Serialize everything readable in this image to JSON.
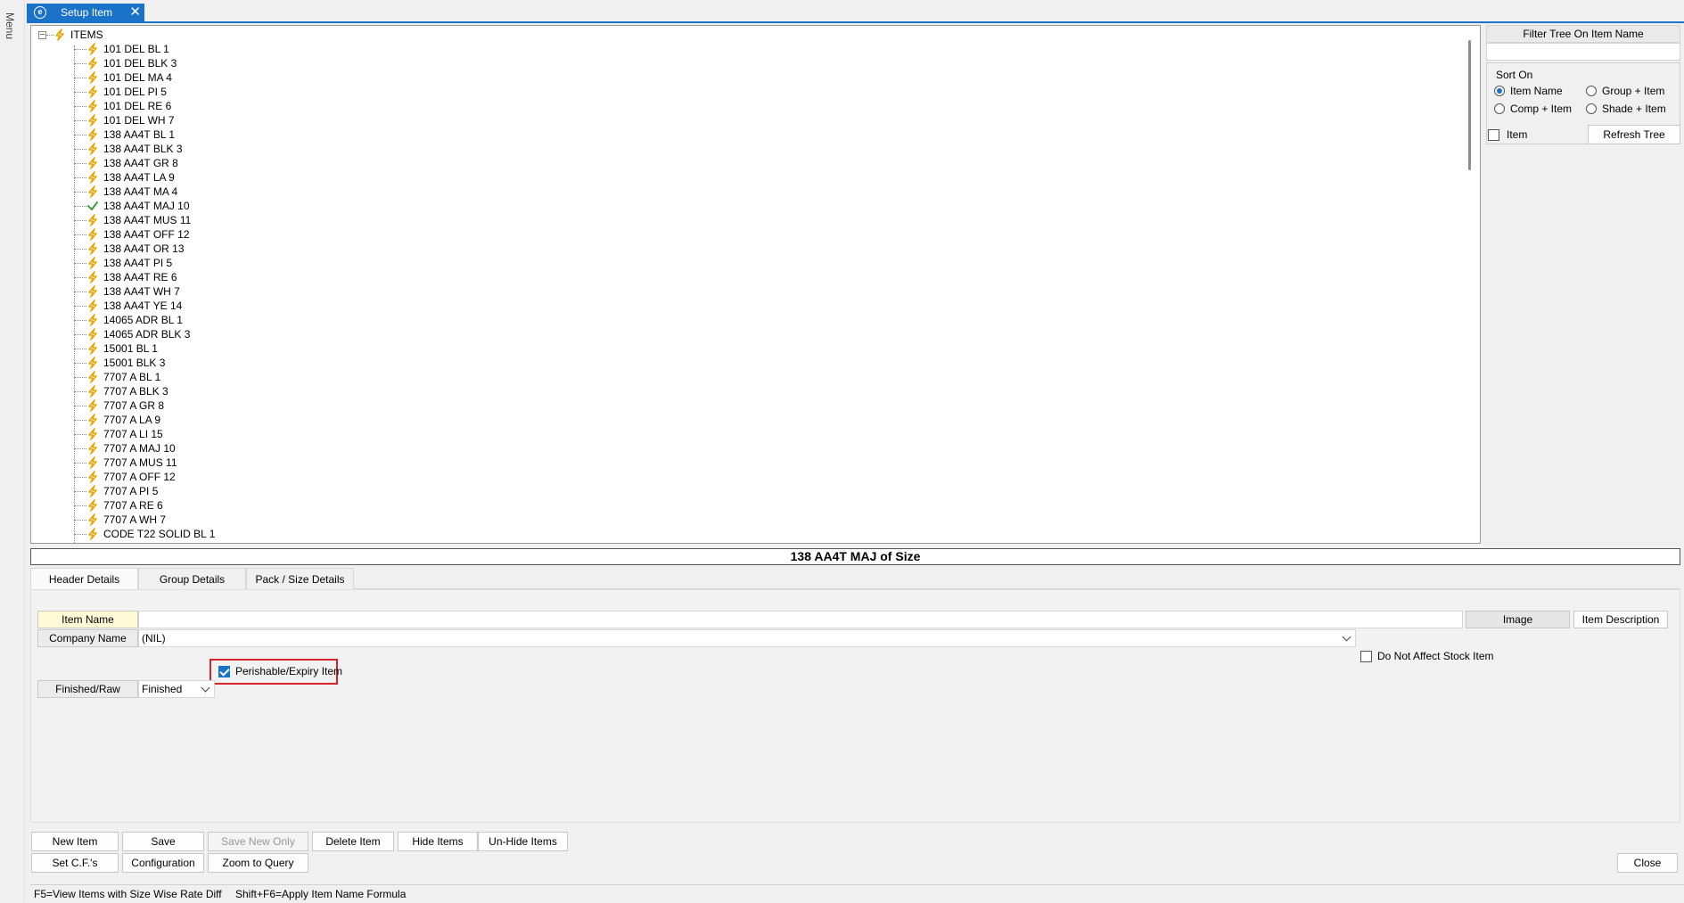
{
  "menu_label": "Menu",
  "window_tab": {
    "title": "Setup Item",
    "close": "✕"
  },
  "tree": {
    "root": "ITEMS",
    "items": [
      {
        "label": "101 DEL BL 1",
        "icon": "bolt"
      },
      {
        "label": "101 DEL BLK 3",
        "icon": "bolt"
      },
      {
        "label": "101 DEL MA 4",
        "icon": "bolt"
      },
      {
        "label": "101 DEL PI 5",
        "icon": "bolt"
      },
      {
        "label": "101 DEL RE 6",
        "icon": "bolt"
      },
      {
        "label": "101 DEL WH 7",
        "icon": "bolt"
      },
      {
        "label": "138 AA4T BL 1",
        "icon": "bolt"
      },
      {
        "label": "138 AA4T BLK 3",
        "icon": "bolt"
      },
      {
        "label": "138 AA4T GR 8",
        "icon": "bolt"
      },
      {
        "label": "138 AA4T LA 9",
        "icon": "bolt"
      },
      {
        "label": "138 AA4T MA 4",
        "icon": "bolt"
      },
      {
        "label": "138 AA4T MAJ 10",
        "icon": "check"
      },
      {
        "label": "138 AA4T MUS 11",
        "icon": "bolt"
      },
      {
        "label": "138 AA4T OFF 12",
        "icon": "bolt"
      },
      {
        "label": "138 AA4T OR 13",
        "icon": "bolt"
      },
      {
        "label": "138 AA4T PI 5",
        "icon": "bolt"
      },
      {
        "label": "138 AA4T RE 6",
        "icon": "bolt"
      },
      {
        "label": "138 AA4T WH 7",
        "icon": "bolt"
      },
      {
        "label": "138 AA4T YE 14",
        "icon": "bolt"
      },
      {
        "label": "14065 ADR BL 1",
        "icon": "bolt"
      },
      {
        "label": "14065 ADR BLK 3",
        "icon": "bolt"
      },
      {
        "label": "15001 BL 1",
        "icon": "bolt"
      },
      {
        "label": "15001 BLK 3",
        "icon": "bolt"
      },
      {
        "label": "7707 A BL 1",
        "icon": "bolt"
      },
      {
        "label": "7707 A BLK 3",
        "icon": "bolt"
      },
      {
        "label": "7707 A GR 8",
        "icon": "bolt"
      },
      {
        "label": "7707 A LA 9",
        "icon": "bolt"
      },
      {
        "label": "7707 A LI 15",
        "icon": "bolt"
      },
      {
        "label": "7707 A MAJ 10",
        "icon": "bolt"
      },
      {
        "label": "7707 A MUS 11",
        "icon": "bolt"
      },
      {
        "label": "7707 A OFF 12",
        "icon": "bolt"
      },
      {
        "label": "7707 A PI 5",
        "icon": "bolt"
      },
      {
        "label": "7707 A RE 6",
        "icon": "bolt"
      },
      {
        "label": "7707 A WH 7",
        "icon": "bolt"
      },
      {
        "label": "CODE T22 SOLID BL 1",
        "icon": "bolt"
      }
    ]
  },
  "filter": {
    "header": "Filter Tree On Item Name",
    "value": "",
    "sort_label": "Sort On",
    "options": [
      {
        "label": "Item Name",
        "selected": true
      },
      {
        "label": "Group + Item",
        "selected": false
      },
      {
        "label": "Comp + Item",
        "selected": false
      },
      {
        "label": "Shade + Item",
        "selected": false
      }
    ],
    "item_checkbox": "Item",
    "refresh": "Refresh Tree"
  },
  "banner": "138 AA4T MAJ  of Size",
  "tabs": [
    "Header Details",
    "Group Details",
    "Pack / Size Details"
  ],
  "form": {
    "item_name_label": "Item Name",
    "item_name_value": "",
    "image_button": "Image",
    "item_desc_button": "Item Description",
    "company_label": "Company Name",
    "company_value": "(NIL)",
    "do_not_affect": "Do Not Affect Stock Item",
    "perishable": "Perishable/Expiry Item",
    "finished_label": "Finished/Raw",
    "finished_value": "Finished"
  },
  "actions": {
    "new_item": "New Item",
    "save": "Save",
    "save_new_only": "Save New Only",
    "delete_item": "Delete Item",
    "hide_items": "Hide Items",
    "unhide_items": "Un-Hide Items",
    "set_cfs": "Set C.F.'s",
    "configuration": "Configuration",
    "zoom": "Zoom to Query",
    "close": "Close"
  },
  "status": {
    "f5": "F5=View Items with Size Wise Rate Diff",
    "shift_f6": "Shift+F6=Apply Item Name Formula"
  },
  "colors": {
    "accent": "#1a73c8",
    "highlight": "#d8232a",
    "bolt": "#e6a800",
    "check": "#3aa43a"
  }
}
